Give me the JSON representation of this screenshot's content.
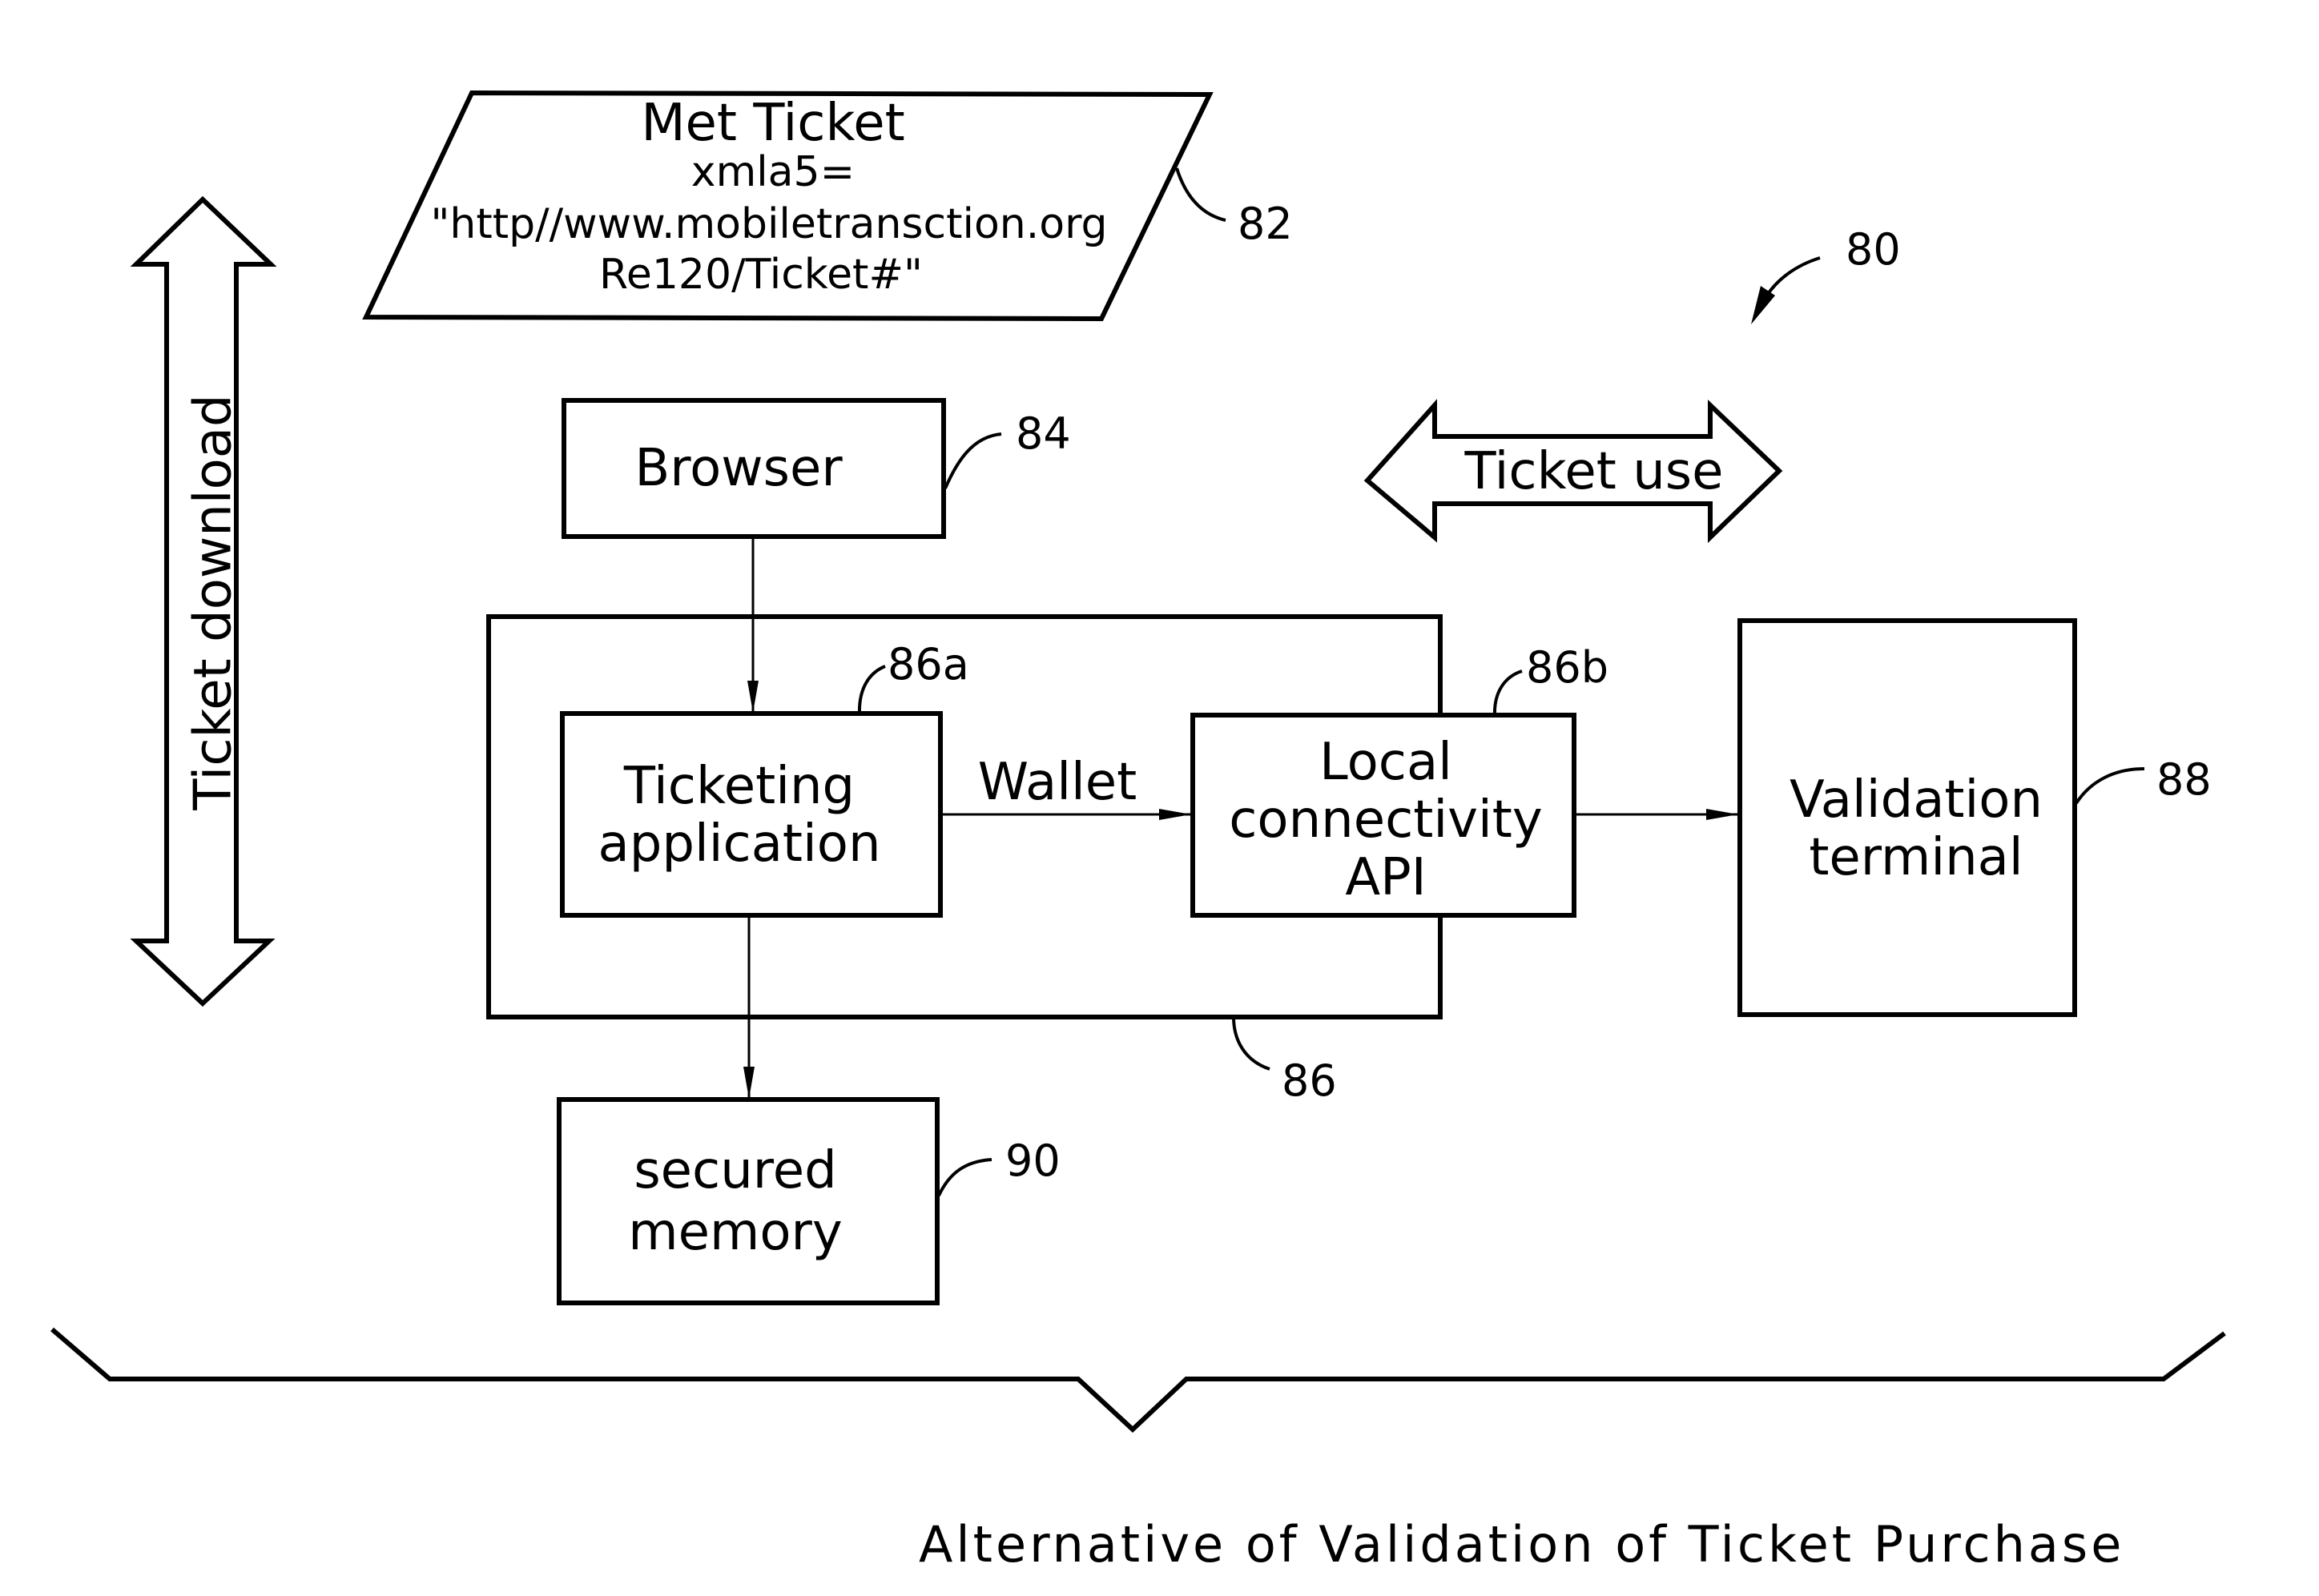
{
  "figure": {
    "reference": "80",
    "caption": "Alternative of Validation of Ticket Purchase"
  },
  "met_ticket": {
    "reference": "82",
    "lines": [
      "Met  Ticket",
      "xmla5=",
      "\"http//www.mobiletransction.org",
      "Re120/Ticket#\""
    ]
  },
  "browser": {
    "label": "Browser",
    "reference": "84"
  },
  "device": {
    "reference": "86"
  },
  "ticketing_application": {
    "lines": [
      "Ticketing",
      "application"
    ],
    "reference": "86a"
  },
  "local_connectivity_api": {
    "lines": [
      "Local",
      "connectivity",
      "API"
    ],
    "reference": "86b"
  },
  "validation_terminal": {
    "lines": [
      "Validation",
      "terminal"
    ],
    "reference": "88"
  },
  "secured_memory": {
    "lines": [
      "secured",
      "memory"
    ],
    "reference": "90"
  },
  "arrows": {
    "wallet_label": "Wallet",
    "ticket_use_label": "Ticket  use",
    "ticket_download_label": "Ticket  download"
  }
}
